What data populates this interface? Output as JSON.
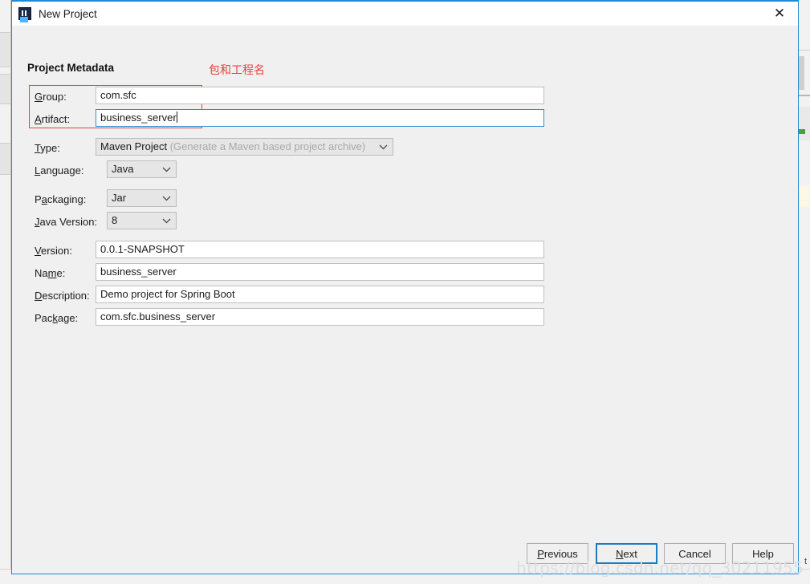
{
  "window": {
    "title": "New Project",
    "icon": "intellij-idea-icon",
    "close_label": "✕",
    "accent_color": "#1f8ad2"
  },
  "section": {
    "title": "Project Metadata",
    "annotation": "包和工程名",
    "annotation_color": "#e8403a",
    "highlight_box_color": "#e8403a"
  },
  "fields": {
    "group": {
      "label_pre": "",
      "label_mnemonic": "G",
      "label_post": "roup:",
      "value": "com.sfc",
      "focused": false
    },
    "artifact": {
      "label_pre": "",
      "label_mnemonic": "A",
      "label_post": "rtifact:",
      "value": "business_server",
      "focused": true
    },
    "type": {
      "label_pre": "",
      "label_mnemonic": "T",
      "label_post": "ype:",
      "value": "Maven Project",
      "hint": "(Generate a Maven based project archive)"
    },
    "language": {
      "label_pre": "",
      "label_mnemonic": "L",
      "label_post": "anguage:",
      "value": "Java"
    },
    "packaging": {
      "label_pre": "P",
      "label_mnemonic": "a",
      "label_post": "ckaging:",
      "value": "Jar"
    },
    "java_version": {
      "label_pre": "",
      "label_mnemonic": "J",
      "label_post": "ava Version:",
      "value": "8"
    },
    "version": {
      "label_pre": "",
      "label_mnemonic": "V",
      "label_post": "ersion:",
      "value": "0.0.1-SNAPSHOT"
    },
    "name": {
      "label_pre": "Na",
      "label_mnemonic": "m",
      "label_post": "e:",
      "value": "business_server"
    },
    "description": {
      "label_pre": "",
      "label_mnemonic": "D",
      "label_post": "escription:",
      "value": "Demo project for Spring Boot"
    },
    "package": {
      "label_pre": "Pac",
      "label_mnemonic": "k",
      "label_post": "age:",
      "value": "com.sfc.business_server"
    }
  },
  "buttons": {
    "previous": {
      "pre": "",
      "mnemonic": "P",
      "post": "revious",
      "primary": false
    },
    "next": {
      "pre": "",
      "mnemonic": "N",
      "post": "ext",
      "primary": true
    },
    "cancel": {
      "pre": "Cancel",
      "mnemonic": "",
      "post": "",
      "primary": false
    },
    "help": {
      "pre": "Help",
      "mnemonic": "",
      "post": "",
      "primary": false
    }
  },
  "watermark": {
    "text": "https://blog.csdn.net/qq_30211955"
  },
  "backdrop": {
    "bottom_right_text": "t"
  }
}
